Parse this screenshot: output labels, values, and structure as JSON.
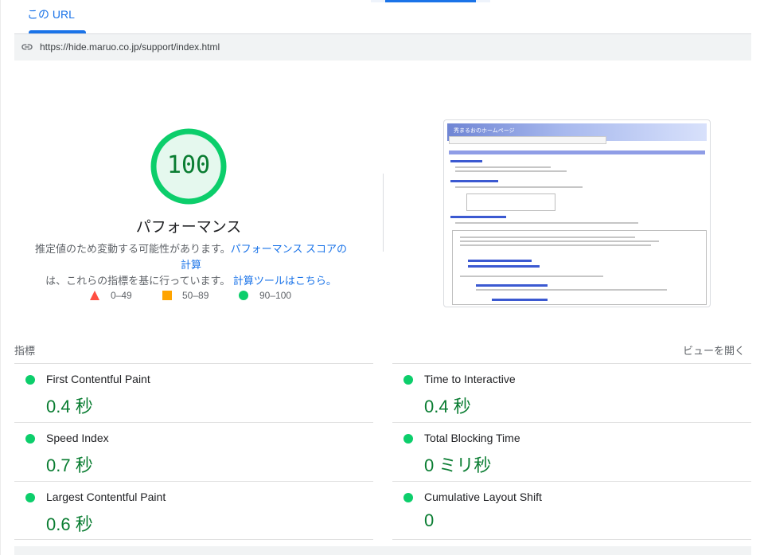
{
  "tab": {
    "label": "この URL"
  },
  "url": {
    "text": "https://hide.maruo.co.jp/support/index.html"
  },
  "score": {
    "value": "100",
    "title": "パフォーマンス",
    "desc_part1": "推定値のため変動する可能性があります。",
    "desc_link1": "パフォーマンス スコアの計算",
    "desc_part2": "は、これらの指標を基に行っています。",
    "desc_link2": "計算ツールはこちら。"
  },
  "legend": {
    "fail": "0–49",
    "average": "50–89",
    "pass": "90–100"
  },
  "thumbnail": {
    "header_text": "秀まるおのホームページ"
  },
  "metrics_section": {
    "title": "指標",
    "expand_label": "ビューを開く"
  },
  "metrics": [
    {
      "name": "First Contentful Paint",
      "value": "0.4 秒"
    },
    {
      "name": "Time to Interactive",
      "value": "0.4 秒"
    },
    {
      "name": "Speed Index",
      "value": "0.7 秒"
    },
    {
      "name": "Total Blocking Time",
      "value": "0 ミリ秒"
    },
    {
      "name": "Largest Contentful Paint",
      "value": "0.6 秒"
    },
    {
      "name": "Cumulative Layout Shift",
      "value": "0"
    }
  ],
  "colors": {
    "accent": "#1a73e8",
    "pass": "#0cce6b",
    "pass_text": "#0a7d32",
    "average": "#ffa400",
    "fail": "#ff4e42"
  }
}
